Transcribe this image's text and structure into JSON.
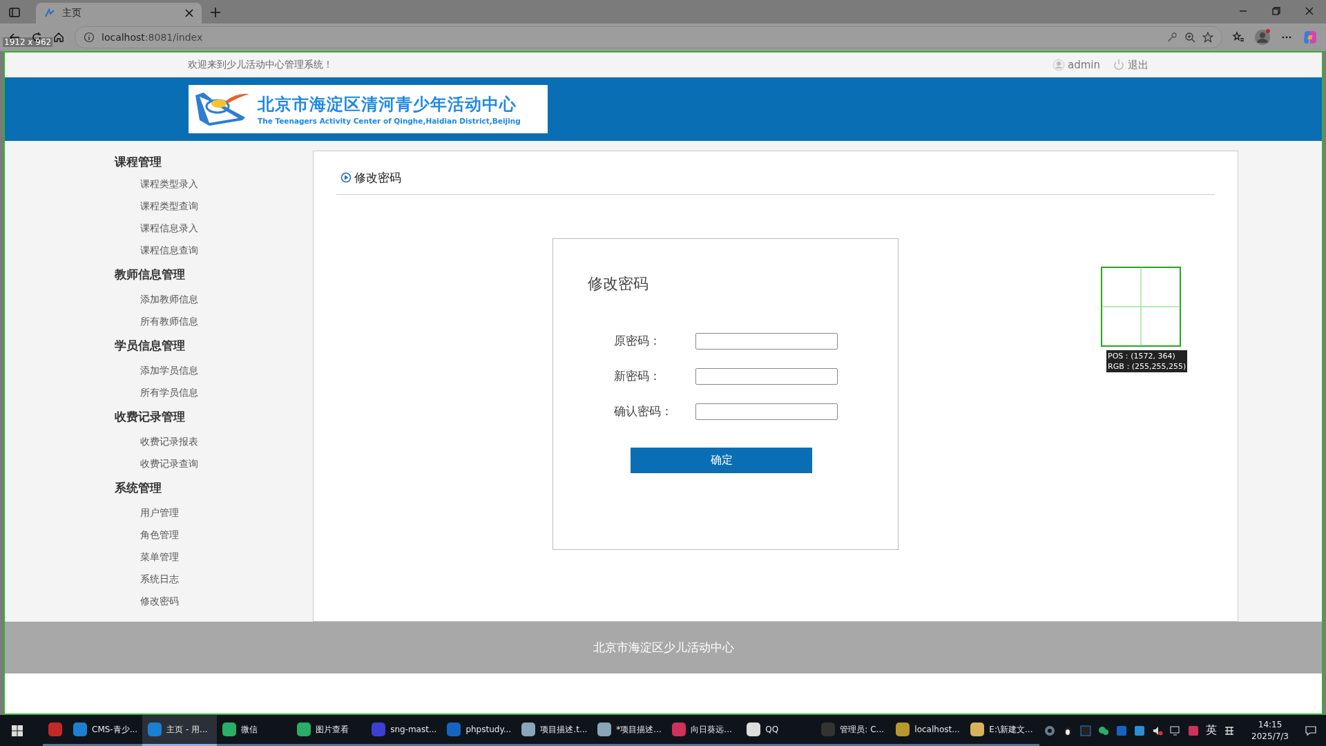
{
  "browser": {
    "tabs": [
      {
        "title": "主页",
        "selected": true
      }
    ],
    "url_host": "localhost",
    "url_path": ":8081/index"
  },
  "capture_overlay": {
    "size_label": "1912 x 962",
    "pos": "POS：(1572, 364)",
    "rgb": "RGB：(255,255,255)"
  },
  "top_bar": {
    "welcome": "欢迎来到少儿活动中心管理系统！",
    "user": "admin",
    "logout": "退出"
  },
  "logo": {
    "title": "北京市海淀区清河青少年活动中心",
    "subtitle": "The Teenagers Activity Center of Qinghe,Haidian District,Beijing"
  },
  "sidebar": {
    "groups": [
      {
        "title": "课程管理",
        "items": [
          "课程类型录入",
          "课程类型查询",
          "课程信息录入",
          "课程信息查询"
        ]
      },
      {
        "title": "教师信息管理",
        "items": [
          "添加教师信息",
          "所有教师信息"
        ]
      },
      {
        "title": "学员信息管理",
        "items": [
          "添加学员信息",
          "所有学员信息"
        ]
      },
      {
        "title": "收费记录管理",
        "items": [
          "收费记录报表",
          "收费记录查询"
        ]
      },
      {
        "title": "系统管理",
        "items": [
          "用户管理",
          "角色管理",
          "菜单管理",
          "系统日志",
          "修改密码"
        ]
      }
    ]
  },
  "main": {
    "title": "修改密码",
    "form": {
      "title": "修改密码",
      "fields": [
        {
          "label": "原密码："
        },
        {
          "label": "新密码："
        },
        {
          "label": "确认密码："
        }
      ],
      "submit": "确定"
    }
  },
  "footer": "北京市海淀区少儿活动中心",
  "taskbar": {
    "apps": [
      {
        "color": "#c62828",
        "selected": false
      },
      {
        "label": "CMS-青少...",
        "color": "#1b7fd4",
        "selected": false
      },
      {
        "label": "主页 - 用...",
        "color": "#1b7fd4",
        "selected": true
      },
      {
        "label": "微信",
        "color": "#2aae67",
        "selected": false
      },
      {
        "label": "图片查看",
        "color": "#2aae67",
        "selected": false
      },
      {
        "label": "sng-mast...",
        "color": "#3c3fd1",
        "selected": false
      },
      {
        "label": "phpstudy...",
        "color": "#1565c0",
        "selected": false
      },
      {
        "label": "项目描述.t...",
        "color": "#8aa4b8",
        "selected": false
      },
      {
        "label": "*项目描述...",
        "color": "#8aa4b8",
        "selected": false
      },
      {
        "label": "向日葵远...",
        "color": "#d0315a",
        "selected": false
      },
      {
        "label": "QQ",
        "color": "#dddddd",
        "selected": false
      },
      {
        "label": "管理员: C...",
        "color": "#333333",
        "selected": false
      },
      {
        "label": "localhost...",
        "color": "#b8972c",
        "selected": false
      },
      {
        "label": "E:\\新建文...",
        "color": "#d8b25a",
        "selected": false
      }
    ],
    "ime": "英",
    "time": "14:15",
    "date": "2025/7/3"
  }
}
